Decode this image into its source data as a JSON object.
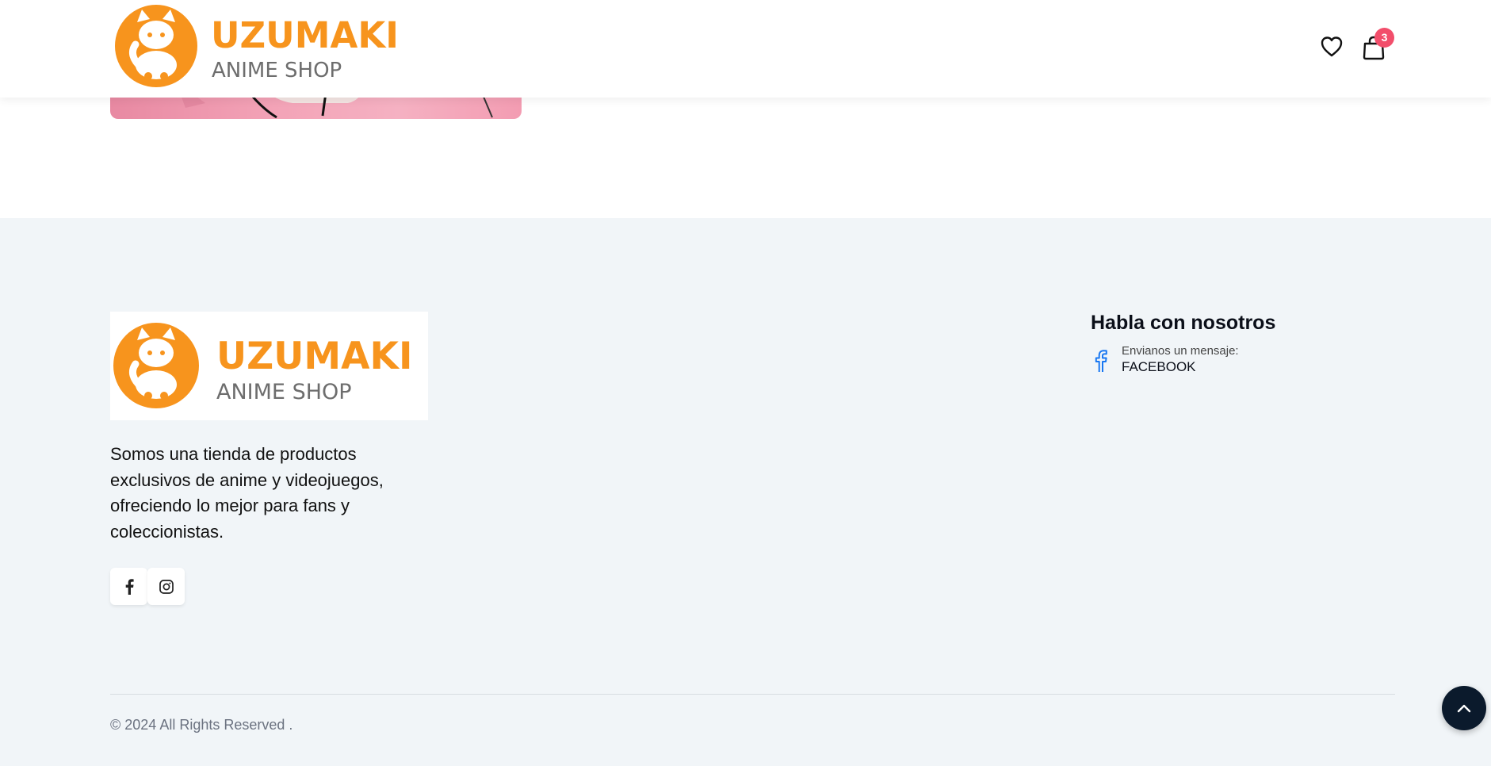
{
  "header": {
    "logo": {
      "brand": "UZUMAKI",
      "tagline": "ANIME SHOP"
    },
    "wishlist_icon": "heart-icon",
    "cart_icon": "shopping-bag-icon",
    "cart_count": "3"
  },
  "footer": {
    "logo": {
      "brand": "UZUMAKI",
      "tagline": "ANIME SHOP"
    },
    "about": "Somos una tienda de productos exclusivos de anime y videojuegos, ofreciendo lo mejor para fans y coleccionistas.",
    "social": [
      {
        "icon": "facebook-icon"
      },
      {
        "icon": "instagram-icon"
      }
    ],
    "contact": {
      "title": "Habla con nosotros",
      "subtitle": "Envianos un mensaje:",
      "link": "FACEBOOK",
      "icon": "facebook-icon"
    },
    "copyright": "© 2024 All Rights Reserved ."
  },
  "colors": {
    "brand_orange": "#f7941d",
    "logo_gray": "#6d6d6d",
    "badge": "#f24e6b",
    "footer_bg": "#f1f5f8",
    "to_top_bg": "#0b1a2c",
    "contact_icon": "#1877f2"
  }
}
